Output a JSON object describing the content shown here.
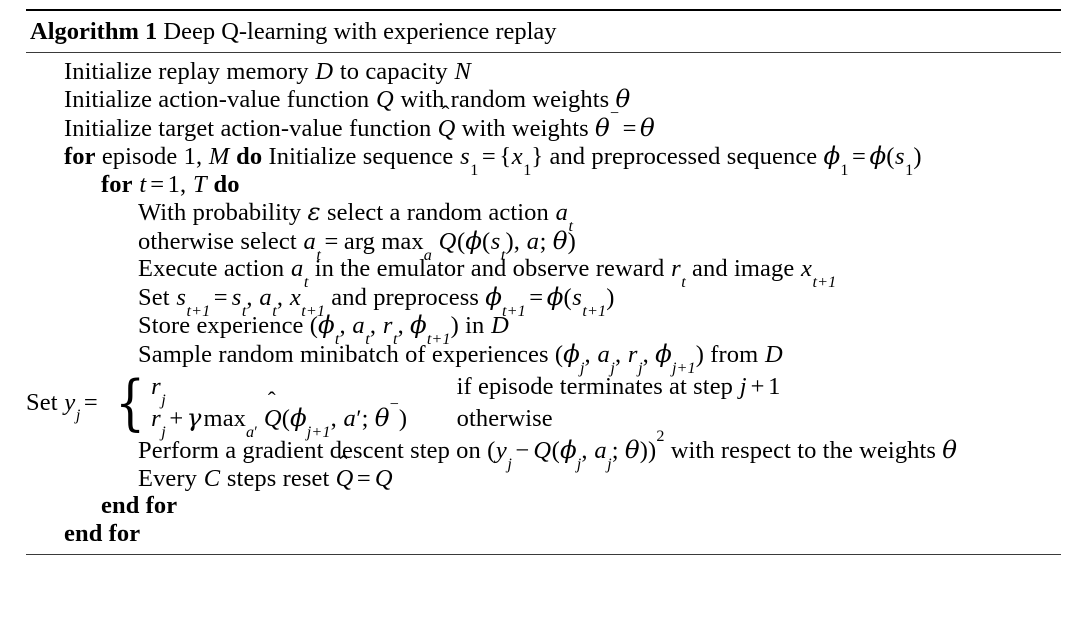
{
  "algorithm": {
    "caption_keyword": "Algorithm 1",
    "caption_title": "Deep Q-learning with experience replay",
    "lines": {
      "init_replay": {
        "pre": "Initialize replay memory ",
        "var1": "D",
        "mid": " to capacity ",
        "var2": "N"
      },
      "init_q": {
        "pre": "Initialize action-value function ",
        "var1": "Q",
        "mid": " with random weights ",
        "var2": "θ"
      },
      "init_target_q": {
        "pre": "Initialize target action-value function ",
        "var1": "Q",
        "hat": "ˆ",
        "mid": " with weights ",
        "var2": "θ",
        "sup": "−",
        "eq": "=",
        "var3": "θ"
      },
      "for_episode": {
        "kw_for": "for",
        "text1": "episode 1,",
        "var_m": "M",
        "kw_do": "do",
        "text2": "Initialize sequence",
        "var_s": "s",
        "sub_s": "1",
        "eq": "=",
        "brace_open": "{",
        "var_x": "x",
        "sub_x": "1",
        "brace_close": "}",
        "text3": "and preprocessed sequence",
        "var_phi": "ϕ",
        "sub_phi": "1",
        "eq2": "=",
        "var_phi2": "ϕ",
        "paren_open": "(",
        "var_s2": "s",
        "sub_s2": "1",
        "paren_close": ")"
      },
      "for_t": {
        "kw_for": "for",
        "var_t": "t",
        "eq": "=",
        "num1": "1",
        "comma": ",",
        "var_T": "T",
        "kw_do": "do"
      },
      "with_probability": {
        "pre": "With probability ",
        "var_eps": "ε",
        "mid": " select a random action ",
        "var_a": "a",
        "sub_a": "t"
      },
      "otherwise_select": {
        "pre": "otherwise select ",
        "var_a": "a",
        "sub_a": "t",
        "eq": "=",
        "op": "arg max",
        "op_sub": "a",
        "var_Q": "Q",
        "paren_open": "(",
        "var_phi": "ϕ",
        "paren_open2": "(",
        "var_s": "s",
        "sub_s": "t",
        "paren_close2": ")",
        "comma": ",",
        "var_a2": "a",
        "semi": ";",
        "var_theta": "θ",
        "paren_close": ")"
      },
      "execute_action": {
        "pre": "Execute action ",
        "var_a": "a",
        "sub_a": "t",
        "mid": " in the emulator and observe reward ",
        "var_r": "r",
        "sub_r": "t",
        "mid2": " and image ",
        "var_x": "x",
        "sub_x": "t+1"
      },
      "set_s": {
        "pre": "Set ",
        "var_s": "s",
        "sub_s": "t+1",
        "eq": "=",
        "var_s2": "s",
        "sub_s2": "t",
        "comma1": ",",
        "var_a": "a",
        "sub_a": "t",
        "comma2": ",",
        "var_x": "x",
        "sub_x": "t+1",
        "mid": " and preprocess ",
        "var_phi": "ϕ",
        "sub_phi": "t+1",
        "eq2": "=",
        "var_phi2": "ϕ",
        "paren_open": "(",
        "var_s3": "s",
        "sub_s3": "t+1",
        "paren_close": ")"
      },
      "store_experience": {
        "pre": "Store experience ",
        "paren_open": "(",
        "var_phi": "ϕ",
        "sub_phi": "t",
        "comma1": ",",
        "var_a": "a",
        "sub_a": "t",
        "comma2": ",",
        "var_r": "r",
        "sub_r": "t",
        "comma3": ",",
        "var_phi2": "ϕ",
        "sub_phi2": "t+1",
        "paren_close": ")",
        "mid": " in ",
        "var_D": "D"
      },
      "sample_minibatch": {
        "pre": "Sample random minibatch of experiences ",
        "paren_open": "(",
        "var_phi": "ϕ",
        "sub_phi": "j",
        "comma1": ",",
        "var_a": "a",
        "sub_a": "j",
        "comma2": ",",
        "var_r": "r",
        "sub_r": "j",
        "comma3": ",",
        "var_phi2": "ϕ",
        "sub_phi2": "j+1",
        "paren_close": ")",
        "mid": " from ",
        "var_D": "D"
      },
      "set_y": {
        "pre": "Set ",
        "var_y": "y",
        "sub_y": "j",
        "eq": "=",
        "case1": {
          "var_r": "r",
          "sub_r": "j",
          "condition": "if episode terminates at step ",
          "cond_var": "j",
          "cond_op": "+",
          "cond_num": "1"
        },
        "case2": {
          "var_r": "r",
          "sub_r": "j",
          "plus": "+",
          "var_gamma": "γ",
          "op": "max",
          "op_sub": "a",
          "op_sub_prime": "′",
          "var_Q": "Q",
          "hat": "ˆ",
          "paren_open": "(",
          "var_phi": "ϕ",
          "sub_phi": "j+1",
          "comma": ",",
          "var_a": "a",
          "prime": "′",
          "semi": ";",
          "var_theta": "θ",
          "sup_theta": "−",
          "paren_close": ")",
          "condition": "otherwise"
        }
      },
      "gradient_descent": {
        "pre": "Perform a gradient descent step on ",
        "paren_open": "(",
        "var_y": "y",
        "sub_y": "j",
        "minus": "−",
        "var_Q": "Q",
        "paren_open2": "(",
        "var_phi": "ϕ",
        "sub_phi": "j",
        "comma": ",",
        "var_a": "a",
        "sub_a": "j",
        "semi": ";",
        "var_theta": "θ",
        "paren_close2": ")",
        "paren_close": ")",
        "sup": "2",
        "mid": " with respect to the weights ",
        "var_theta2": "θ"
      },
      "every_c": {
        "pre": "Every ",
        "var_C": "C",
        "mid": " steps reset ",
        "var_Q": "Q",
        "hat": "ˆ",
        "eq": "=",
        "var_Q2": "Q"
      },
      "end_for_inner": "end for",
      "end_for_outer": "end for"
    }
  }
}
